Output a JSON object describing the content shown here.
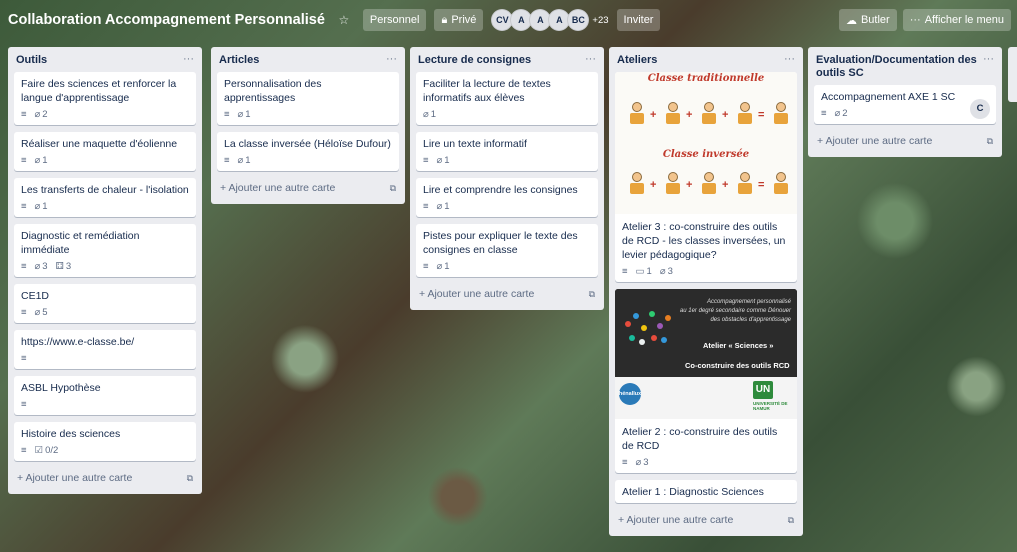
{
  "board": {
    "title": "Collaboration Accompagnement Personnalisé",
    "visibility_team": "Personnel",
    "visibility_private": "Privé",
    "members": [
      "CV",
      "A",
      "A",
      "A",
      "BC"
    ],
    "members_more": "+23",
    "invite_label": "Inviter",
    "butler_label": "Butler",
    "show_menu_label": "Afficher le menu",
    "ellipsis": "···"
  },
  "lists": [
    {
      "title": "Outils",
      "cards": [
        {
          "title": "Faire des sciences et renforcer la langue d'apprentissage",
          "description": true,
          "attachments": "2"
        },
        {
          "title": "Réaliser une maquette d'éolienne",
          "description": true,
          "attachments": "1"
        },
        {
          "title": "Les transferts de chaleur - l'isolation",
          "description": true,
          "attachments": "1"
        },
        {
          "title": "Diagnostic et remédiation immédiate",
          "description": true,
          "attachments": "3",
          "trello_count": "3"
        },
        {
          "title": "CE1D",
          "description": true,
          "attachments": "5"
        },
        {
          "title": "https://www.e-classe.be/",
          "description": true
        },
        {
          "title": "ASBL Hypothèse",
          "description": true
        },
        {
          "title": "Histoire des sciences",
          "description": true,
          "checklist": "0/2"
        }
      ],
      "add_label": "+ Ajouter une autre carte"
    },
    {
      "title": "Articles",
      "cards": [
        {
          "title": "Personnalisation des apprentissages",
          "description": true,
          "attachments": "1"
        },
        {
          "title": "La classe inversée (Héloïse Dufour)",
          "description": true,
          "attachments": "1"
        }
      ],
      "add_label": "+ Ajouter une autre carte"
    },
    {
      "title": "Lecture de consignes",
      "cards": [
        {
          "title": "Faciliter la lecture de textes informatifs aux élèves",
          "attachments": "1"
        },
        {
          "title": "Lire un texte informatif",
          "description": true,
          "attachments": "1"
        },
        {
          "title": "Lire et comprendre les consignes",
          "description": true,
          "attachments": "1"
        },
        {
          "title": "Pistes pour expliquer le texte des consignes en classe",
          "description": true,
          "attachments": "1"
        }
      ],
      "add_label": "+ Ajouter une autre carte"
    },
    {
      "title": "Ateliers",
      "cards": [
        {
          "title": "Atelier 3 : co-construire des outils de RCD - les classes inversées, un levier pédagogique?",
          "description": true,
          "comments": "1",
          "attachments": "3",
          "cover": {
            "heading_top": "Classe traditionnelle",
            "heading_mid": "Classe inversée"
          }
        },
        {
          "title": "Atelier 2 : co-construire des outils de RCD",
          "description": true,
          "attachments": "3",
          "cover": {
            "line1": "Accompagnement personnalisé",
            "line2": "au 1er degré secondaire comme Dénouer",
            "line3": "des obstacles d'apprentissage",
            "atelier": "Atelier « Sciences »",
            "coconstruire": "Co-construire des outils RCD",
            "logo_left": "hénallux",
            "logo_right": "UN",
            "unamur": "UNIVERSITÉ DE NAMUR"
          }
        },
        {
          "title": "Atelier 1 : Diagnostic Sciences"
        }
      ],
      "add_label": "+ Ajouter une autre carte"
    },
    {
      "title": "Evaluation/Documentation des outils SC",
      "cards": [
        {
          "title": "Accompagnement AXE 1 SC",
          "description": true,
          "attachments": "2",
          "member": "C"
        }
      ],
      "add_label": "+ Ajouter une autre carte"
    }
  ]
}
